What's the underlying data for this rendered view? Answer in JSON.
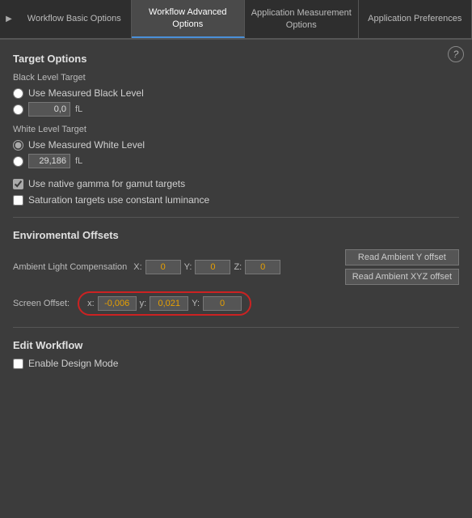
{
  "tabs": [
    {
      "id": "workflow-basic",
      "label": "Workflow Basic Options",
      "active": false
    },
    {
      "id": "workflow-advanced",
      "label": "Workflow Advanced Options",
      "active": true
    },
    {
      "id": "app-measurement",
      "label": "Application Measurement Options",
      "active": false
    },
    {
      "id": "app-preferences",
      "label": "Application Preferences",
      "active": false
    }
  ],
  "tab_arrow": "▶",
  "help_icon": "?",
  "target_options": {
    "title": "Target Options",
    "black_level": {
      "label": "Black Level Target",
      "option1": "Use Measured Black Level",
      "option2_value": "0,0",
      "option2_unit": "fL"
    },
    "white_level": {
      "label": "White Level Target",
      "option1": "Use Measured White Level",
      "option2_value": "29,186",
      "option2_unit": "fL"
    },
    "checkbox1": {
      "label": "Use native gamma for gamut targets",
      "checked": true
    },
    "checkbox2": {
      "label": "Saturation targets use constant luminance",
      "checked": false
    }
  },
  "environmental_offsets": {
    "title": "Enviromental Offsets",
    "ambient_light": {
      "label": "Ambient Light Compensation",
      "x_label": "X:",
      "y_label": "Y:",
      "z_label": "Z:",
      "x_value": "0",
      "y_value": "0",
      "z_value": "0"
    },
    "btn_ambient_y": "Read Ambient Y offset",
    "btn_ambient_xyz": "Read Ambient XYZ offset",
    "screen_offset": {
      "label": "Screen Offset:",
      "x_label": "x:",
      "y_label": "y:",
      "Y_label": "Y:",
      "x_value": "-0,006",
      "y_value": "0,021",
      "Y_value": "0"
    }
  },
  "edit_workflow": {
    "title": "Edit Workflow",
    "checkbox1": {
      "label": "Enable Design Mode",
      "checked": false
    }
  }
}
